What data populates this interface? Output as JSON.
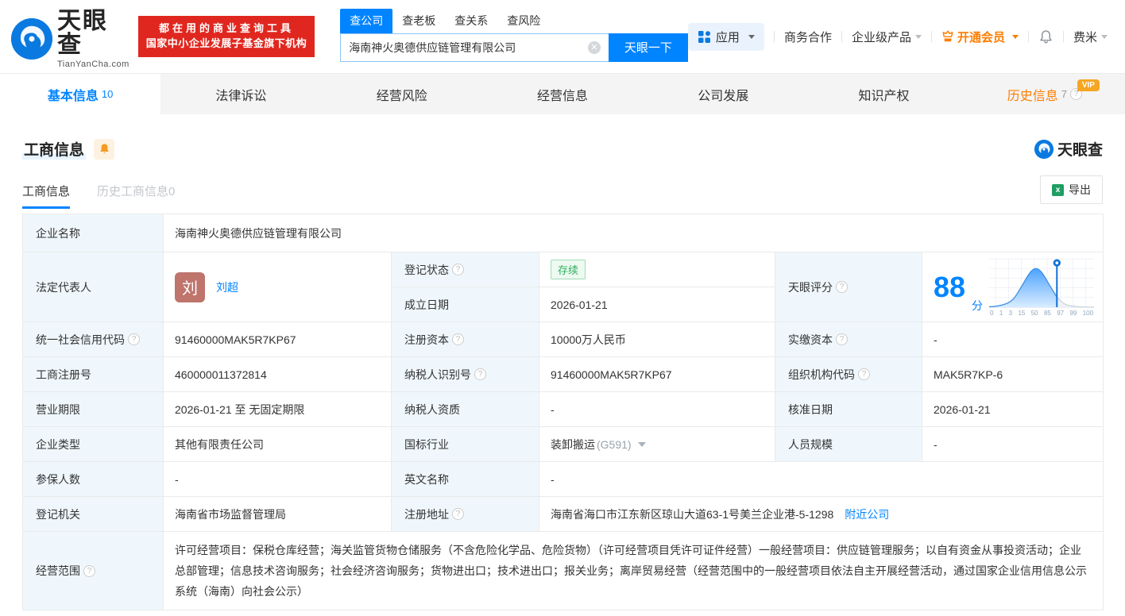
{
  "brand": {
    "name": "天眼查",
    "domain": "TianYanCha.com",
    "watermark": "天眼查"
  },
  "promo": {
    "line1": "都在用的商业查询工具",
    "line2": "国家中小企业发展子基金旗下机构"
  },
  "search": {
    "tabs": [
      "查公司",
      "查老板",
      "查关系",
      "查风险"
    ],
    "value": "海南神火奥德供应链管理有限公司",
    "submit": "天眼一下"
  },
  "topnav": {
    "apps": "应用",
    "cooperation": "商务合作",
    "enterprise": "企业级产品",
    "membership": "开通会员",
    "username": "费米"
  },
  "nav_tabs": {
    "basic": {
      "label": "基本信息",
      "count": "10"
    },
    "legal": {
      "label": "法律诉讼"
    },
    "risk": {
      "label": "经营风险"
    },
    "operation": {
      "label": "经营信息"
    },
    "development": {
      "label": "公司发展"
    },
    "ip": {
      "label": "知识产权"
    },
    "history": {
      "label": "历史信息",
      "count": "7",
      "badge": "VIP"
    }
  },
  "section": {
    "title": "工商信息",
    "tab_current": "工商信息",
    "tab_history": "历史工商信息0",
    "export_label": "导出"
  },
  "fields": {
    "company_name": {
      "label": "企业名称",
      "value": "海南神火奥德供应链管理有限公司"
    },
    "legal_rep": {
      "label": "法定代表人",
      "avatar": "刘",
      "name": "刘超"
    },
    "reg_status": {
      "label": "登记状态",
      "value": "存续"
    },
    "establish_date": {
      "label": "成立日期",
      "value": "2026-01-21"
    },
    "credit_code": {
      "label": "统一社会信用代码",
      "value": "91460000MAK5R7KP67"
    },
    "reg_capital": {
      "label": "注册资本",
      "value": "10000万人民币"
    },
    "paid_capital": {
      "label": "实缴资本",
      "value": "-"
    },
    "reg_number": {
      "label": "工商注册号",
      "value": "460000011372814"
    },
    "taxpayer_id": {
      "label": "纳税人识别号",
      "value": "91460000MAK5R7KP67"
    },
    "org_code": {
      "label": "组织机构代码",
      "value": "MAK5R7KP-6"
    },
    "business_term": {
      "label": "营业期限",
      "value": "2026-01-21 至 无固定期限"
    },
    "taxpayer_quality": {
      "label": "纳税人资质",
      "value": "-"
    },
    "approval_date": {
      "label": "核准日期",
      "value": "2026-01-21"
    },
    "company_type": {
      "label": "企业类型",
      "value": "其他有限责任公司"
    },
    "industry": {
      "label": "国标行业",
      "value": "装卸搬运",
      "code": "(G591)"
    },
    "staff_size": {
      "label": "人员规模",
      "value": "-"
    },
    "insured_count": {
      "label": "参保人数",
      "value": "-"
    },
    "english_name": {
      "label": "英文名称",
      "value": "-"
    },
    "reg_authority": {
      "label": "登记机关",
      "value": "海南省市场监督管理局"
    },
    "reg_address": {
      "label": "注册地址",
      "value": "海南省海口市江东新区琼山大道63-1号美兰企业港-5-1298",
      "link": "附近公司"
    },
    "business_scope": {
      "label": "经营范围",
      "value": "许可经营项目：保税仓库经营；海关监管货物仓储服务（不含危险化学品、危险货物）（许可经营项目凭许可证件经营）一般经营项目：供应链管理服务；以自有资金从事投资活动；企业总部管理；信息技术咨询服务；社会经济咨询服务；货物进出口；技术进出口；报关业务；离岸贸易经营（经营范围中的一般经营项目依法自主开展经营活动，通过国家企业信用信息公示系统（海南）向社会公示）"
    }
  },
  "score": {
    "label": "天眼评分",
    "value": "88",
    "unit": "分",
    "ticks": [
      "0",
      "1",
      "3",
      "15",
      "50",
      "85",
      "97",
      "99",
      "100"
    ]
  },
  "colors": {
    "primary_blue": "#0084ff",
    "promo_red": "#e0271f",
    "vip_orange": "#ff7d00",
    "status_green": "#2fae5d",
    "avatar_rose": "#bf746c",
    "label_bg": "#eff7fc"
  }
}
